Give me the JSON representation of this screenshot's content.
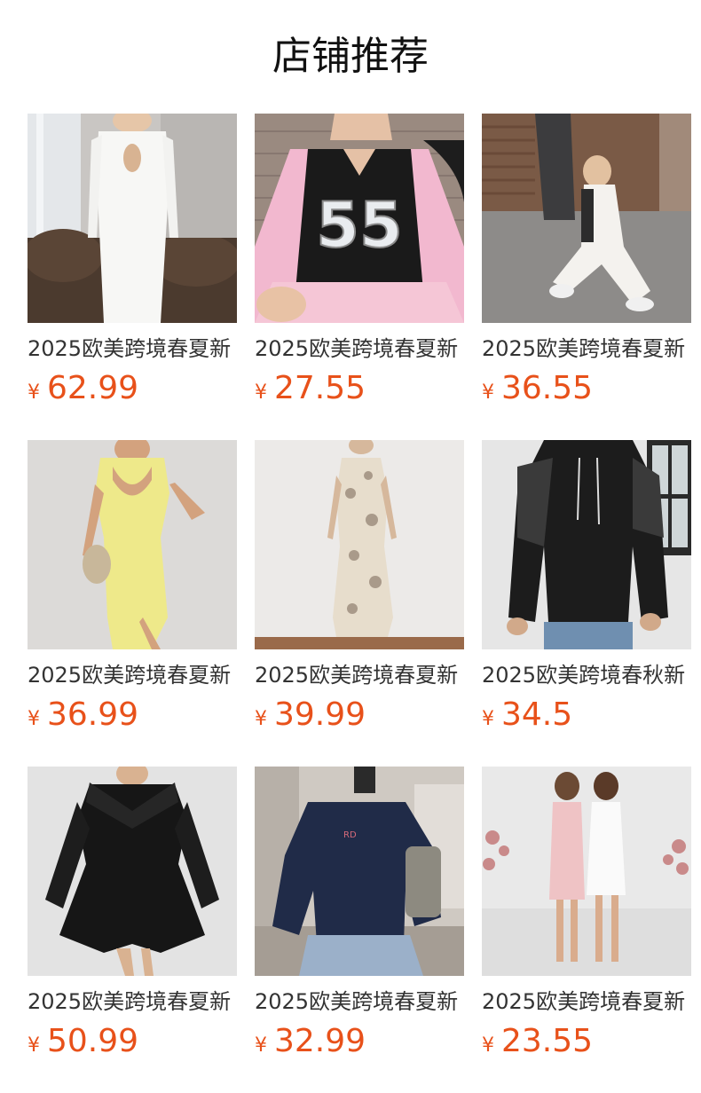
{
  "section": {
    "title": "店铺推荐"
  },
  "currency_symbol": "¥",
  "colors": {
    "price": "#e8511a",
    "text": "#333333"
  },
  "products": [
    {
      "name": "2025欧美跨境春夏新",
      "price": "62.99",
      "image": "white-long-dress-photo"
    },
    {
      "name": "2025欧美跨境春夏新",
      "price": "27.55",
      "image": "number-55-jersey-photo"
    },
    {
      "name": "2025欧美跨境春夏新",
      "price": "36.55",
      "image": "white-jumpsuit-photo"
    },
    {
      "name": "2025欧美跨境春夏新",
      "price": "36.99",
      "image": "yellow-bodycon-dress-photo"
    },
    {
      "name": "2025欧美跨境春夏新",
      "price": "39.99",
      "image": "floral-slip-dress-photo"
    },
    {
      "name": "2025欧美跨境春秋新",
      "price": "34.5",
      "image": "black-lace-hoodie-photo"
    },
    {
      "name": "2025欧美跨境春夏新",
      "price": "50.99",
      "image": "black-collar-dress-photo"
    },
    {
      "name": "2025欧美跨境春夏新",
      "price": "32.99",
      "image": "navy-sweatshirt-photo"
    },
    {
      "name": "2025欧美跨境春夏新",
      "price": "23.55",
      "image": "pink-white-mini-dresses-photo"
    }
  ]
}
